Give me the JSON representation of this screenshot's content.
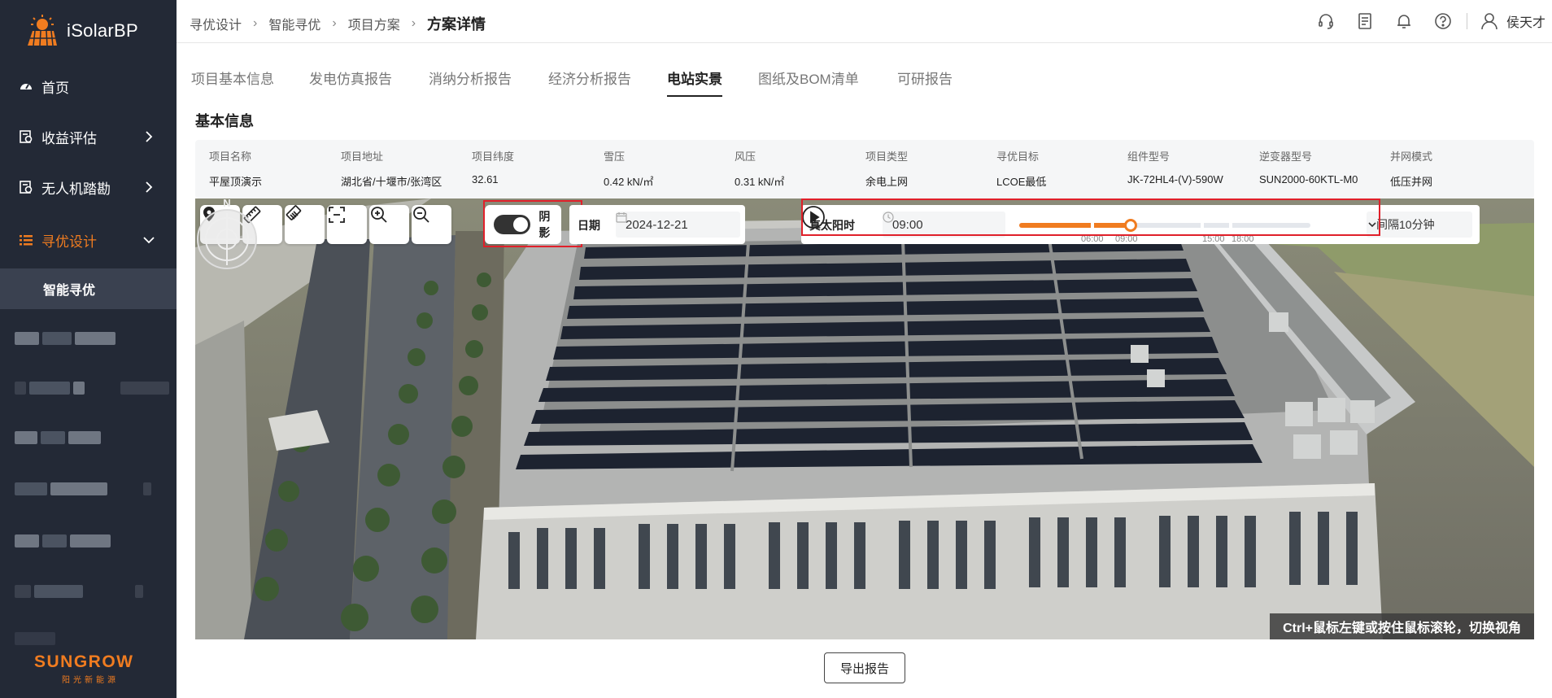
{
  "app": {
    "logo_text": "iSolarBP",
    "brand_name": "SUNGROW",
    "brand_sub": "阳光新能源"
  },
  "sidebar": {
    "items": [
      {
        "label": "首页",
        "icon": "dashboard-icon"
      },
      {
        "label": "收益评估",
        "icon": "assessment-icon"
      },
      {
        "label": "无人机踏勘",
        "icon": "drone-survey-icon"
      },
      {
        "label": "寻优设计",
        "icon": "list-icon",
        "active": true
      },
      {
        "label": "智能寻优",
        "sub": true
      }
    ]
  },
  "breadcrumb": {
    "items": [
      "寻优设计",
      "智能寻优",
      "项目方案"
    ],
    "current": "方案详情"
  },
  "header": {
    "user_name": "侯天才"
  },
  "tabs": [
    "项目基本信息",
    "发电仿真报告",
    "消纳分析报告",
    "经济分析报告",
    "电站实景",
    "图纸及BOM清单",
    "可研报告"
  ],
  "active_tab": "电站实景",
  "section_title": "基本信息",
  "info": {
    "headers": [
      "项目名称",
      "项目地址",
      "项目纬度",
      "雪压",
      "风压",
      "项目类型",
      "寻优目标",
      "组件型号",
      "逆变器型号",
      "并网模式"
    ],
    "values": [
      "平屋顶演示",
      "湖北省/十堰市/张湾区",
      "32.61",
      "0.42 kN/㎡",
      "0.31 kN/㎡",
      "余电上网",
      "LCOE最低",
      "JK-72HL4-(V)-590W",
      "SUN2000-60KTL-M0",
      "低压并网"
    ]
  },
  "scene": {
    "shadow_label": "阴影",
    "shadow_on": true,
    "date_label": "日期",
    "date_value": "2024-12-21",
    "time_label": "真太阳时",
    "time_value": "09:00",
    "slider_ticks": [
      "06:00",
      "09:00",
      "15:00",
      "18:00"
    ],
    "slider_value": "09:00",
    "interval": "间隔10分钟",
    "compass_label": "N",
    "hint": "Ctrl+鼠标左键或按住鼠标滚轮，切换视角"
  },
  "export_button": "导出报告",
  "colors": {
    "accent": "#f07c20",
    "sidebar_bg": "#232936",
    "highlight_box": "#e0202a"
  }
}
